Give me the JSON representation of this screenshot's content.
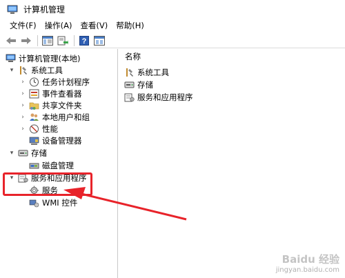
{
  "window": {
    "title": "计算机管理"
  },
  "menu": [
    "文件(F)",
    "操作(A)",
    "查看(V)",
    "帮助(H)"
  ],
  "toolbar": {
    "buttons": [
      "back-arrow-icon",
      "forward-arrow-icon",
      "show-tree-icon",
      "export-list-icon",
      "help-icon",
      "properties-icon"
    ]
  },
  "tree": {
    "root": "计算机管理(本地)",
    "system_tools": "系统工具",
    "task_scheduler": "任务计划程序",
    "event_viewer": "事件查看器",
    "shared_folders": "共享文件夹",
    "local_users": "本地用户和组",
    "performance": "性能",
    "device_manager": "设备管理器",
    "storage": "存储",
    "disk_management": "磁盘管理",
    "services_apps": "服务和应用程序",
    "services": "服务",
    "wmi": "WMI 控件"
  },
  "list": {
    "header": "名称",
    "items": [
      "系统工具",
      "存储",
      "服务和应用程序"
    ]
  },
  "annotation": {
    "color": "#e8232a"
  },
  "watermark": {
    "logo": "Baidu 经验",
    "url": "jingyan.baidu.com"
  }
}
